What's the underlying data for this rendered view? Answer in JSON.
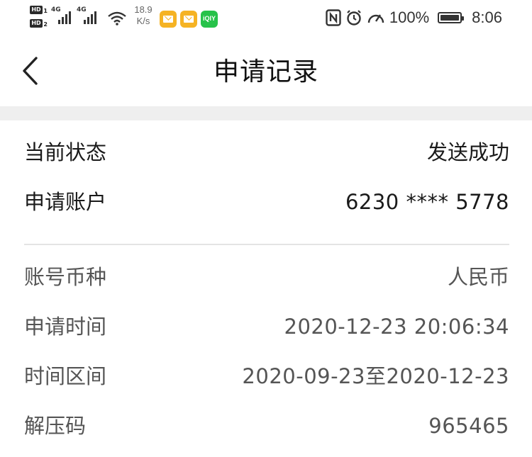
{
  "status_bar": {
    "hd_badge_1": "HD",
    "hd_badge_1_sub": "1",
    "hd_badge_2": "HD",
    "hd_badge_2_sub": "2",
    "network_type_1": "4G",
    "network_type_2": "4G",
    "speed_value": "18.9",
    "speed_unit": "K/s",
    "app_icon_3_text": "iQIY",
    "battery_text": "100%",
    "time": "8:06",
    "icons": [
      "hd-badge",
      "signal-icon",
      "wifi-icon",
      "mail-icon",
      "mail-icon",
      "iqiyi-icon",
      "nfc-icon",
      "alarm-icon",
      "speed-icon",
      "battery-icon"
    ]
  },
  "nav": {
    "title": "申请记录",
    "back_icon": "chevron-left-icon"
  },
  "details": {
    "primary": [
      {
        "label": "当前状态",
        "value": "发送成功"
      },
      {
        "label": "申请账户",
        "value": "6230 **** 5778"
      }
    ],
    "secondary": [
      {
        "label": "账号币种",
        "value": "人民币"
      },
      {
        "label": "申请时间",
        "value": "2020-12-23 20:06:34"
      },
      {
        "label": "时间区间",
        "value": "2020-09-23至2020-12-23"
      },
      {
        "label": "解压码",
        "value": "965465"
      }
    ]
  },
  "colors": {
    "background": "#ffffff",
    "divider_band": "#efefef",
    "primary_text": "#1a1a1a",
    "secondary_text": "#555555",
    "app_orange": "#f5b324",
    "app_green": "#27c24a"
  }
}
